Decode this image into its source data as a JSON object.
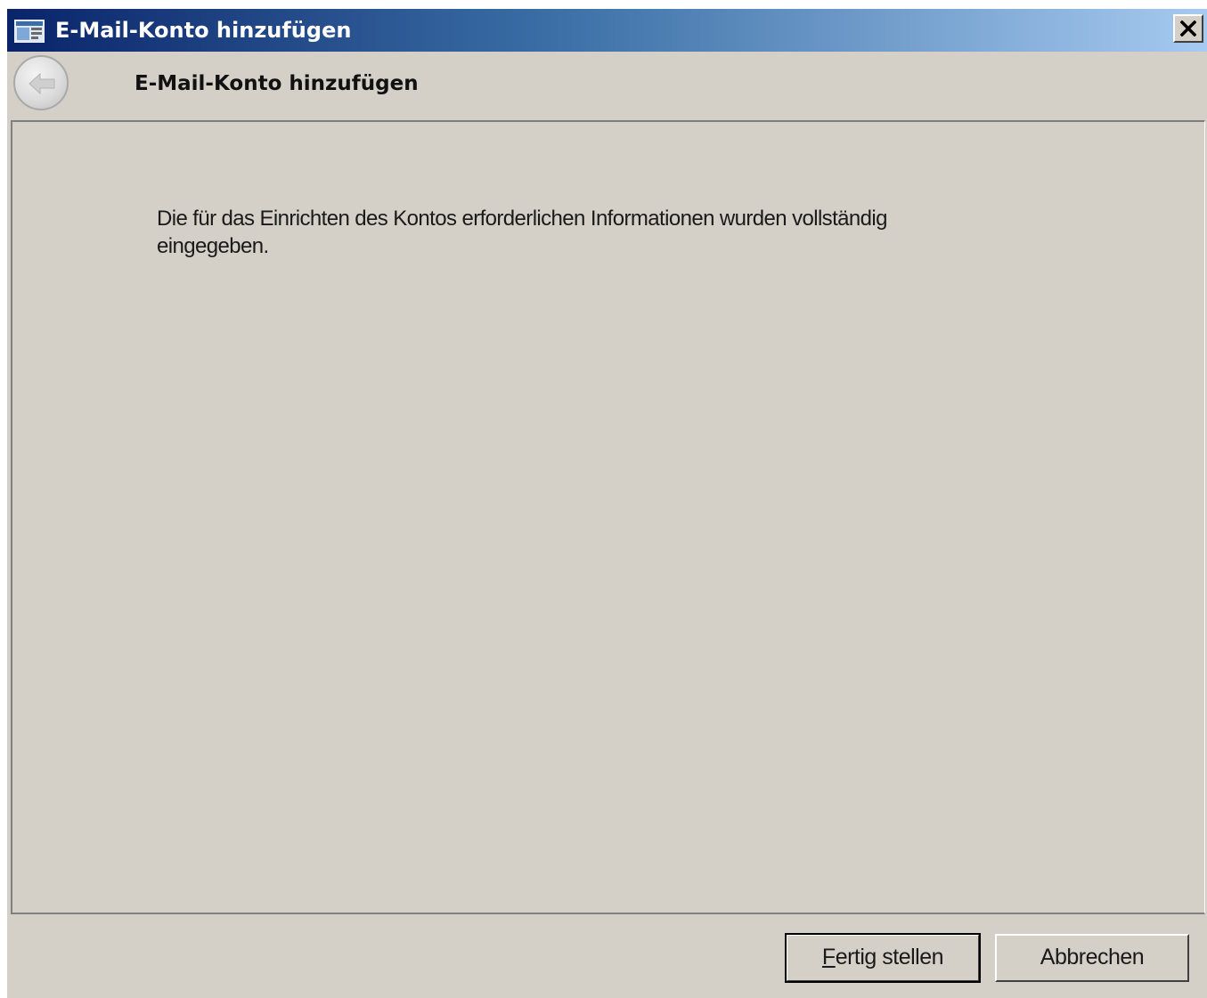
{
  "window": {
    "title": "E-Mail-Konto hinzufügen",
    "icon": "app-window-icon",
    "close_label": "close-icon"
  },
  "header": {
    "back_icon": "back-arrow-icon",
    "title": "E-Mail-Konto hinzufügen"
  },
  "content": {
    "message": "Die für das Einrichten des Kontos erforderlichen Informationen wurden vollständig eingegeben."
  },
  "footer": {
    "finish_mnemonic": "F",
    "finish_rest": "ertig stellen",
    "cancel_label": "Abbrechen"
  },
  "colors": {
    "titlebar_start": "#0a246a",
    "titlebar_end": "#a6caf0",
    "dialog_bg": "#d4d0c8"
  }
}
